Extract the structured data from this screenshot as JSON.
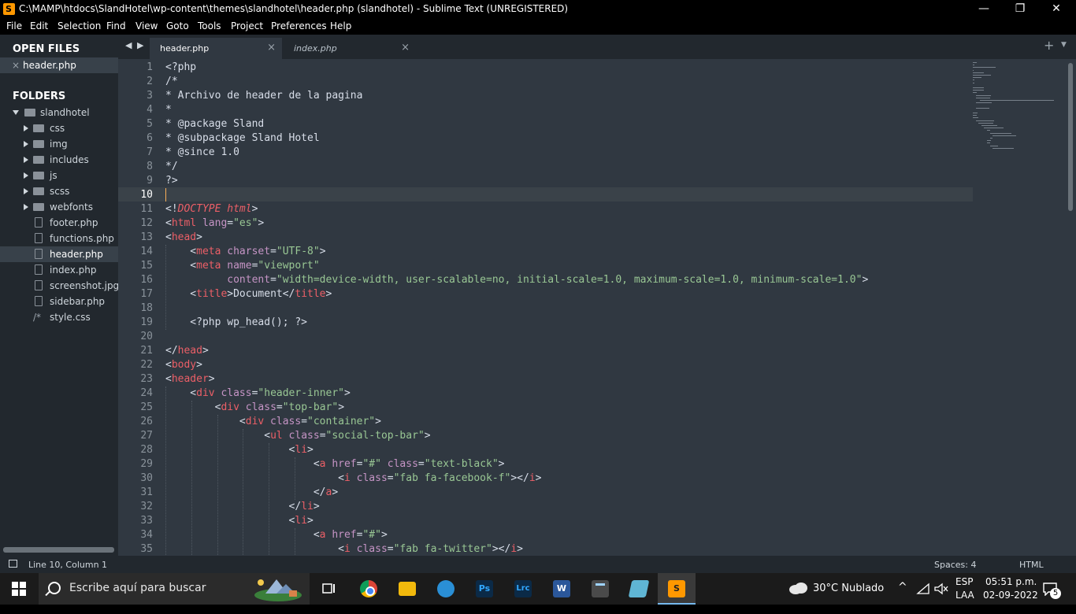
{
  "window": {
    "title": "C:\\MAMP\\htdocs\\SlandHotel\\wp-content\\themes\\slandhotel\\header.php (slandhotel) - Sublime Text (UNREGISTERED)",
    "minimize": "—",
    "maximize": "❐",
    "close": "✕"
  },
  "menu": [
    "File",
    "Edit",
    "Selection",
    "Find",
    "View",
    "Goto",
    "Tools",
    "Project",
    "Preferences",
    "Help"
  ],
  "sidebar": {
    "open_files_label": "OPEN FILES",
    "open_files": [
      {
        "name": "header.php",
        "close": "×"
      }
    ],
    "folders_label": "FOLDERS",
    "root": "slandhotel",
    "items": [
      {
        "name": "css",
        "type": "folder"
      },
      {
        "name": "img",
        "type": "folder"
      },
      {
        "name": "includes",
        "type": "folder"
      },
      {
        "name": "js",
        "type": "folder"
      },
      {
        "name": "scss",
        "type": "folder"
      },
      {
        "name": "webfonts",
        "type": "folder"
      },
      {
        "name": "footer.php",
        "type": "file"
      },
      {
        "name": "functions.php",
        "type": "file"
      },
      {
        "name": "header.php",
        "type": "file",
        "selected": true
      },
      {
        "name": "index.php",
        "type": "file"
      },
      {
        "name": "screenshot.jpg",
        "type": "file"
      },
      {
        "name": "sidebar.php",
        "type": "file"
      },
      {
        "name": "style.css",
        "type": "css",
        "prefix": "/*"
      }
    ]
  },
  "tabs": {
    "nav_left": "◀",
    "nav_right": "▶",
    "items": [
      {
        "label": "header.php",
        "active": true,
        "close": "×"
      },
      {
        "label": "index.php",
        "active": false,
        "close": "×"
      }
    ],
    "add": "+",
    "more": "▼"
  },
  "editor": {
    "current_line": 10,
    "lines": [
      {
        "n": "1",
        "t": [
          [
            "p",
            "<?php"
          ]
        ]
      },
      {
        "n": "2",
        "t": [
          [
            "p",
            "/*"
          ]
        ]
      },
      {
        "n": "3",
        "t": [
          [
            "p",
            "* Archivo de header de la pagina"
          ]
        ]
      },
      {
        "n": "4",
        "t": [
          [
            "p",
            "*"
          ]
        ]
      },
      {
        "n": "5",
        "t": [
          [
            "p",
            "* @package Sland"
          ]
        ]
      },
      {
        "n": "6",
        "t": [
          [
            "p",
            "* @subpackage Sland Hotel"
          ]
        ]
      },
      {
        "n": "7",
        "t": [
          [
            "p",
            "* @since 1.0"
          ]
        ]
      },
      {
        "n": "8",
        "t": [
          [
            "p",
            "*/"
          ]
        ]
      },
      {
        "n": "9",
        "t": [
          [
            "p",
            "?>"
          ]
        ]
      },
      {
        "n": "10",
        "t": []
      },
      {
        "n": "11",
        "t": [
          [
            "p",
            "<!"
          ],
          [
            "ki",
            "DOCTYPE"
          ],
          [
            "p",
            " "
          ],
          [
            "ki",
            "html"
          ],
          [
            "p",
            ">"
          ]
        ]
      },
      {
        "n": "12",
        "t": [
          [
            "p",
            "<"
          ],
          [
            "k",
            "html"
          ],
          [
            "a",
            " lang"
          ],
          [
            "p",
            "="
          ],
          [
            "s",
            "\"es\""
          ],
          [
            "p",
            ">"
          ]
        ]
      },
      {
        "n": "13",
        "t": [
          [
            "p",
            "<"
          ],
          [
            "k",
            "head"
          ],
          [
            "p",
            ">"
          ]
        ]
      },
      {
        "n": "14",
        "t": [
          [
            "p",
            "    <"
          ],
          [
            "k",
            "meta"
          ],
          [
            "a",
            " charset"
          ],
          [
            "p",
            "="
          ],
          [
            "s",
            "\"UTF-8\""
          ],
          [
            "p",
            ">"
          ]
        ]
      },
      {
        "n": "15",
        "t": [
          [
            "p",
            "    <"
          ],
          [
            "k",
            "meta"
          ],
          [
            "a",
            " name"
          ],
          [
            "p",
            "="
          ],
          [
            "s",
            "\"viewport\""
          ]
        ]
      },
      {
        "n": "16",
        "t": [
          [
            "a",
            "          content"
          ],
          [
            "p",
            "="
          ],
          [
            "s",
            "\"width=device-width, user-scalable=no, initial-scale=1.0, maximum-scale=1.0, minimum-scale=1.0\""
          ],
          [
            "p",
            ">"
          ]
        ]
      },
      {
        "n": "17",
        "t": [
          [
            "p",
            "    <"
          ],
          [
            "k",
            "title"
          ],
          [
            "p",
            ">Document</"
          ],
          [
            "k",
            "title"
          ],
          [
            "p",
            ">"
          ]
        ]
      },
      {
        "n": "18",
        "t": []
      },
      {
        "n": "19",
        "t": [
          [
            "p",
            "    <?php wp_head(); ?>"
          ]
        ]
      },
      {
        "n": "20",
        "t": []
      },
      {
        "n": "21",
        "t": [
          [
            "p",
            "</"
          ],
          [
            "k",
            "head"
          ],
          [
            "p",
            ">"
          ]
        ]
      },
      {
        "n": "22",
        "t": [
          [
            "p",
            "<"
          ],
          [
            "k",
            "body"
          ],
          [
            "p",
            ">"
          ]
        ]
      },
      {
        "n": "23",
        "t": [
          [
            "p",
            "<"
          ],
          [
            "k",
            "header"
          ],
          [
            "p",
            ">"
          ]
        ]
      },
      {
        "n": "24",
        "t": [
          [
            "p",
            "    <"
          ],
          [
            "k",
            "div"
          ],
          [
            "a",
            " class"
          ],
          [
            "p",
            "="
          ],
          [
            "s",
            "\"header-inner\""
          ],
          [
            "p",
            ">"
          ]
        ]
      },
      {
        "n": "25",
        "t": [
          [
            "p",
            "        <"
          ],
          [
            "k",
            "div"
          ],
          [
            "a",
            " class"
          ],
          [
            "p",
            "="
          ],
          [
            "s",
            "\"top-bar\""
          ],
          [
            "p",
            ">"
          ]
        ]
      },
      {
        "n": "26",
        "t": [
          [
            "p",
            "            <"
          ],
          [
            "k",
            "div"
          ],
          [
            "a",
            " class"
          ],
          [
            "p",
            "="
          ],
          [
            "s",
            "\"container\""
          ],
          [
            "p",
            ">"
          ]
        ]
      },
      {
        "n": "27",
        "t": [
          [
            "p",
            "                <"
          ],
          [
            "k",
            "ul"
          ],
          [
            "a",
            " class"
          ],
          [
            "p",
            "="
          ],
          [
            "s",
            "\"social-top-bar\""
          ],
          [
            "p",
            ">"
          ]
        ]
      },
      {
        "n": "28",
        "t": [
          [
            "p",
            "                    <"
          ],
          [
            "k",
            "li"
          ],
          [
            "p",
            ">"
          ]
        ]
      },
      {
        "n": "29",
        "t": [
          [
            "p",
            "                        <"
          ],
          [
            "k",
            "a"
          ],
          [
            "a",
            " href"
          ],
          [
            "p",
            "="
          ],
          [
            "s",
            "\"#\""
          ],
          [
            "a",
            " class"
          ],
          [
            "p",
            "="
          ],
          [
            "s",
            "\"text-black\""
          ],
          [
            "p",
            ">"
          ]
        ]
      },
      {
        "n": "30",
        "t": [
          [
            "p",
            "                            <"
          ],
          [
            "k",
            "i"
          ],
          [
            "a",
            " class"
          ],
          [
            "p",
            "="
          ],
          [
            "s",
            "\"fab fa-facebook-f\""
          ],
          [
            "p",
            "></"
          ],
          [
            "k",
            "i"
          ],
          [
            "p",
            ">"
          ]
        ]
      },
      {
        "n": "31",
        "t": [
          [
            "p",
            "                        </"
          ],
          [
            "k",
            "a"
          ],
          [
            "p",
            ">"
          ]
        ]
      },
      {
        "n": "32",
        "t": [
          [
            "p",
            "                    </"
          ],
          [
            "k",
            "li"
          ],
          [
            "p",
            ">"
          ]
        ]
      },
      {
        "n": "33",
        "t": [
          [
            "p",
            "                    <"
          ],
          [
            "k",
            "li"
          ],
          [
            "p",
            ">"
          ]
        ]
      },
      {
        "n": "34",
        "t": [
          [
            "p",
            "                        <"
          ],
          [
            "k",
            "a"
          ],
          [
            "a",
            " href"
          ],
          [
            "p",
            "="
          ],
          [
            "s",
            "\"#\""
          ],
          [
            "p",
            ">"
          ]
        ]
      },
      {
        "n": "35",
        "t": [
          [
            "p",
            "                            <"
          ],
          [
            "k",
            "i"
          ],
          [
            "a",
            " class"
          ],
          [
            "p",
            "="
          ],
          [
            "s",
            "\"fab fa-twitter\""
          ],
          [
            "p",
            "></"
          ],
          [
            "k",
            "i"
          ],
          [
            "p",
            ">"
          ]
        ]
      }
    ]
  },
  "status": {
    "position": "Line 10, Column 1",
    "spaces": "Spaces: 4",
    "syntax": "HTML"
  },
  "taskbar": {
    "search_placeholder": "Escribe aquí para buscar",
    "apps": [
      {
        "name": "chrome-icon",
        "label": "",
        "color": "#dd4b39"
      },
      {
        "name": "file-explorer-icon",
        "label": "",
        "color": "#f2b90c"
      },
      {
        "name": "paint-icon",
        "label": "",
        "color": "#2a8fd6"
      },
      {
        "name": "photoshop-icon",
        "label": "Ps",
        "color": "#0b2a47"
      },
      {
        "name": "lightroom-classic-icon",
        "label": "Lrc",
        "color": "#0b2a47"
      },
      {
        "name": "word-icon",
        "label": "W",
        "color": "#2b579a"
      },
      {
        "name": "calculator-icon",
        "label": "",
        "color": "#4a4a4a"
      },
      {
        "name": "notes-icon",
        "label": "",
        "color": "#5fb5d4"
      },
      {
        "name": "sublime-text-icon",
        "label": "S",
        "color": "#ff9800"
      }
    ],
    "weather": "30°C  Nublado",
    "language_top": "ESP",
    "language_bottom": "LAA",
    "time": "05:51 p.m.",
    "date": "02-09-2022",
    "notifications": "5"
  },
  "colors": {
    "bg": "#303841",
    "keyword": "#ec5f67",
    "attribute": "#c594c5",
    "string": "#99c794",
    "plain": "#d8dee9"
  }
}
